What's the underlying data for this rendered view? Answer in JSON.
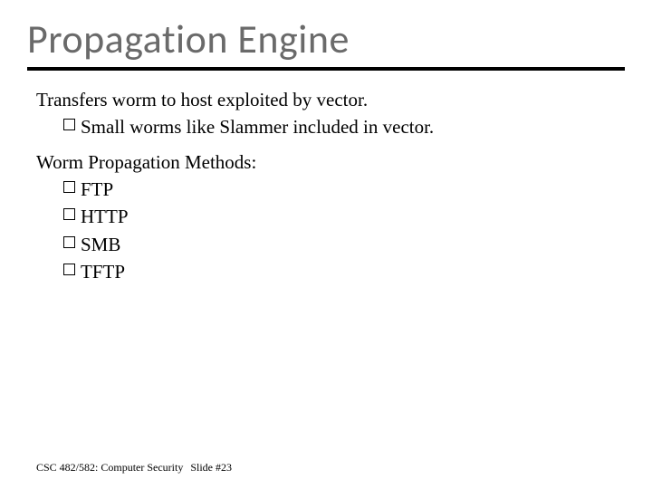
{
  "title": "Propagation Engine",
  "body": {
    "para1": "Transfers worm to host exploited by vector.",
    "para1_sub1": "Small worms like Slammer included in vector.",
    "para2": "Worm Propagation Methods:",
    "methods": {
      "m0": "FTP",
      "m1": "HTTP",
      "m2": "SMB",
      "m3": "TFTP"
    }
  },
  "footer": {
    "course": "CSC 482/582: Computer Security",
    "slide": "Slide #23"
  }
}
